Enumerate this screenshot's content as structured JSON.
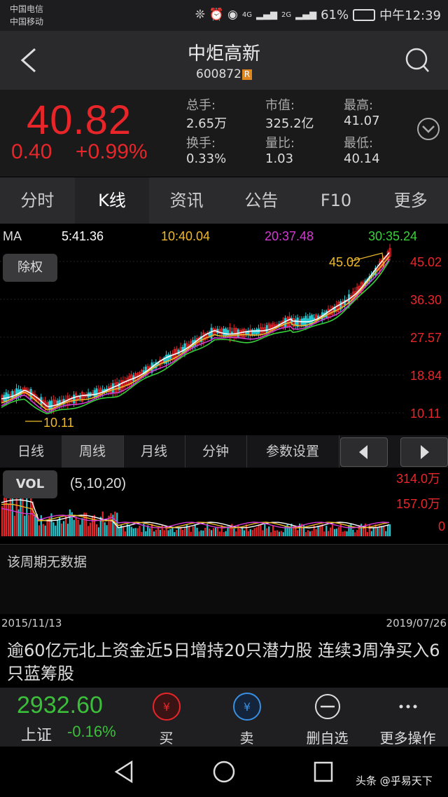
{
  "status": {
    "carrier1": "中国电信",
    "carrier2": "中国移动",
    "icons_left": "❊ ⏰ ◉",
    "net1": "4G",
    "net2": "2G",
    "battery": "61%",
    "time": "中午12:39"
  },
  "header": {
    "back_icon": "chevron-left",
    "title": "中炬高新",
    "code": "600872",
    "badge": "R",
    "search_icon": "search"
  },
  "quote": {
    "price": "40.82",
    "change": "0.40",
    "change_pct": "+0.99%",
    "fields": [
      {
        "label": "总手:",
        "value": "2.65万"
      },
      {
        "label": "市值:",
        "value": "325.2亿"
      },
      {
        "label": "最高:",
        "value": "41.07"
      },
      {
        "label": "换手:",
        "value": "0.33%"
      },
      {
        "label": "量比:",
        "value": "1.03"
      },
      {
        "label": "最低:",
        "value": "40.14"
      }
    ],
    "up_color": "#e8262a"
  },
  "tabs": [
    "分时",
    "K线",
    "资讯",
    "公告",
    "F10",
    "更多"
  ],
  "active_tab": "K线",
  "kline": {
    "ma_label": "MA",
    "ma5": "5:41.36",
    "ma10": "10:40.04",
    "ma20": "20:37.48",
    "ma30": "30:35.24",
    "ma_colors": {
      "ma5": "#ffffff",
      "ma10": "#f0b92a",
      "ma20": "#d33ad3",
      "ma30": "#37d13a"
    },
    "restore_btn": "除权",
    "high_label": "45.02",
    "low_label": "10.11",
    "y_ticks": [
      "45.02",
      "36.30",
      "27.57",
      "18.84",
      "10.11"
    ]
  },
  "period_tabs": [
    "日线",
    "周线",
    "月线",
    "分钟",
    "参数设置"
  ],
  "active_period": "周线",
  "volume": {
    "label": "VOL",
    "params": "(5,10,20)",
    "y_ticks": [
      "314.0万",
      "157.0万",
      "0"
    ]
  },
  "info": {
    "text": "该周期无数据"
  },
  "dates": {
    "start": "2015/11/13",
    "end": "2019/07/26"
  },
  "news": {
    "headline": "逾60亿元北上资金近5日增持20只潜力股 连续3周净买入6只蓝筹股"
  },
  "index": {
    "value": "2932.60",
    "name": "上证",
    "change": "-0.16%",
    "value_color": "#3bbf3b"
  },
  "actions": [
    {
      "label": "买",
      "icon": "cart-yen-icon"
    },
    {
      "label": "卖",
      "icon": "cart-yen-icon"
    },
    {
      "label": "删自选",
      "icon": "minus-circle-icon"
    },
    {
      "label": "更多操作",
      "icon": "more-dots-icon"
    }
  ],
  "watermark": "头条 @乎易天下"
}
